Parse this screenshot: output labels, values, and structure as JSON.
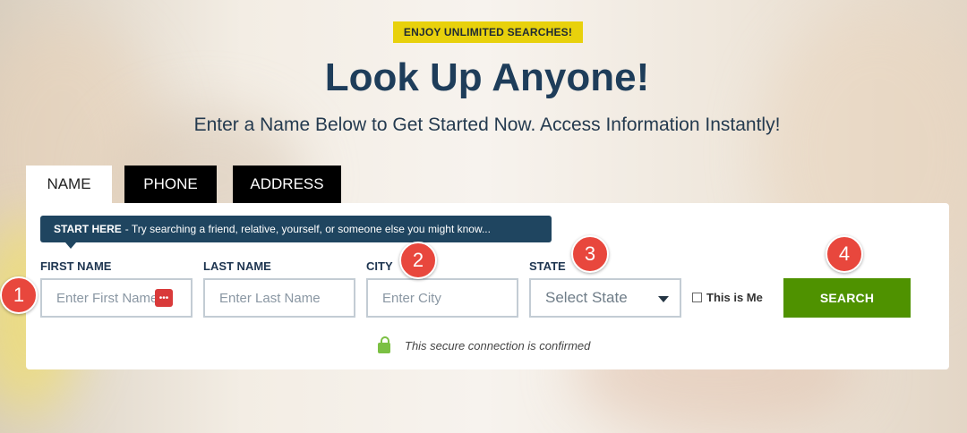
{
  "promo": {
    "badge": "ENJOY UNLIMITED SEARCHES!"
  },
  "hero": {
    "title": "Look Up Anyone!",
    "subtitle": "Enter a Name Below to Get Started Now. Access Information Instantly!"
  },
  "tabs": [
    {
      "label": "NAME",
      "active": true
    },
    {
      "label": "PHONE",
      "active": false
    },
    {
      "label": "ADDRESS",
      "active": false
    }
  ],
  "tooltip": {
    "strong": "START HERE",
    "text": "- Try searching a friend, relative, yourself, or someone else you might know..."
  },
  "form": {
    "first_name": {
      "label": "FIRST NAME",
      "placeholder": "Enter First Name"
    },
    "last_name": {
      "label": "LAST NAME",
      "placeholder": "Enter Last Name"
    },
    "city": {
      "label": "CITY",
      "placeholder": "Enter City"
    },
    "state": {
      "label": "STATE",
      "selected": "Select State"
    },
    "this_is_me": "This is Me",
    "search_label": "SEARCH",
    "secure_text": "This secure connection is confirmed"
  },
  "markers": [
    "1",
    "2",
    "3",
    "4"
  ],
  "colors": {
    "badge": "#e8d10c",
    "title": "#1e3d5a",
    "tooltip": "#1f4560",
    "search": "#4f9200",
    "marker": "#e8473d",
    "lock": "#7bc043"
  },
  "icons": {
    "password_manager": "password-manager-icon",
    "lock": "lock-icon",
    "caret": "chevron-down-icon"
  }
}
